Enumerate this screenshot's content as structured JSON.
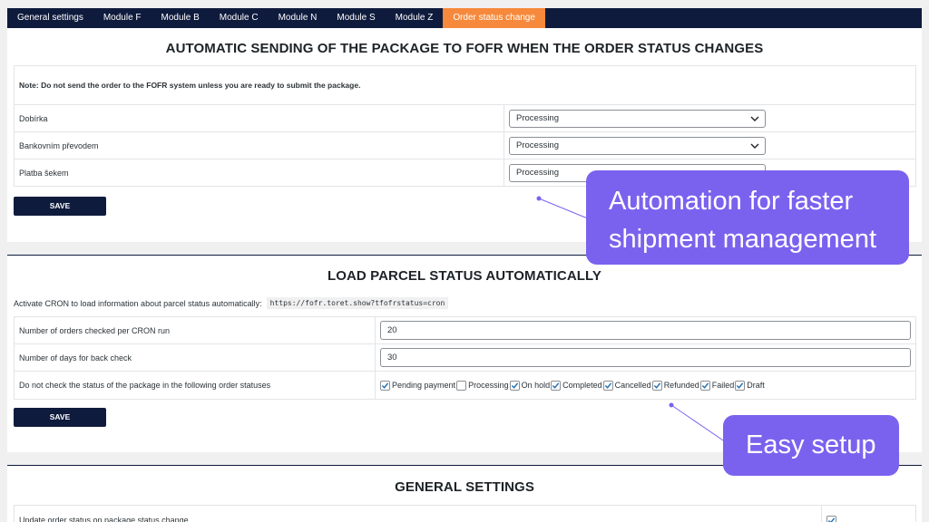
{
  "tabs": [
    {
      "label": "General settings",
      "active": false
    },
    {
      "label": "Module F",
      "active": false
    },
    {
      "label": "Module B",
      "active": false
    },
    {
      "label": "Module C",
      "active": false
    },
    {
      "label": "Module N",
      "active": false
    },
    {
      "label": "Module S",
      "active": false
    },
    {
      "label": "Module Z",
      "active": false
    },
    {
      "label": "Order status change",
      "active": true
    }
  ],
  "auto_send": {
    "title": "AUTOMATIC SENDING OF THE PACKAGE TO FOFR WHEN THE ORDER STATUS CHANGES",
    "note": "Note: Do not send the order to the FOFR system unless you are ready to submit the package.",
    "rows": [
      {
        "label": "Dobírka",
        "value": "Processing"
      },
      {
        "label": "Bankovním převodem",
        "value": "Processing"
      },
      {
        "label": "Platba šekem",
        "value": "Processing"
      }
    ],
    "save_label": "SAVE"
  },
  "parcel_status": {
    "title": "LOAD PARCEL STATUS AUTOMATICALLY",
    "cron_text": "Activate CRON to load information about parcel status automatically:",
    "cron_url": "https://fofr.toret.show?tfofrstatus=cron",
    "orders_per_run_label": "Number of orders checked per CRON run",
    "orders_per_run_value": "20",
    "days_back_label": "Number of days for back check",
    "days_back_value": "30",
    "exclude_label": "Do not check the status of the package in the following order statuses",
    "statuses": [
      {
        "label": "Pending payment",
        "checked": true
      },
      {
        "label": "Processing",
        "checked": false
      },
      {
        "label": "On hold",
        "checked": true
      },
      {
        "label": "Completed",
        "checked": true
      },
      {
        "label": "Cancelled",
        "checked": true
      },
      {
        "label": "Refunded",
        "checked": true
      },
      {
        "label": "Failed",
        "checked": true
      },
      {
        "label": "Draft",
        "checked": true
      }
    ],
    "save_label": "SAVE"
  },
  "general_settings": {
    "title": "GENERAL SETTINGS",
    "update_status_label": "Update order status on package status change",
    "update_status_checked": true
  },
  "callouts": {
    "automation_line1": "Automation for faster",
    "automation_line2": "shipment management",
    "easy_setup": "Easy setup"
  },
  "colors": {
    "navy": "#0f1b3d",
    "active_tab": "#f6893b",
    "callout": "#7b62ee",
    "checkbox_check": "#2271b1"
  }
}
